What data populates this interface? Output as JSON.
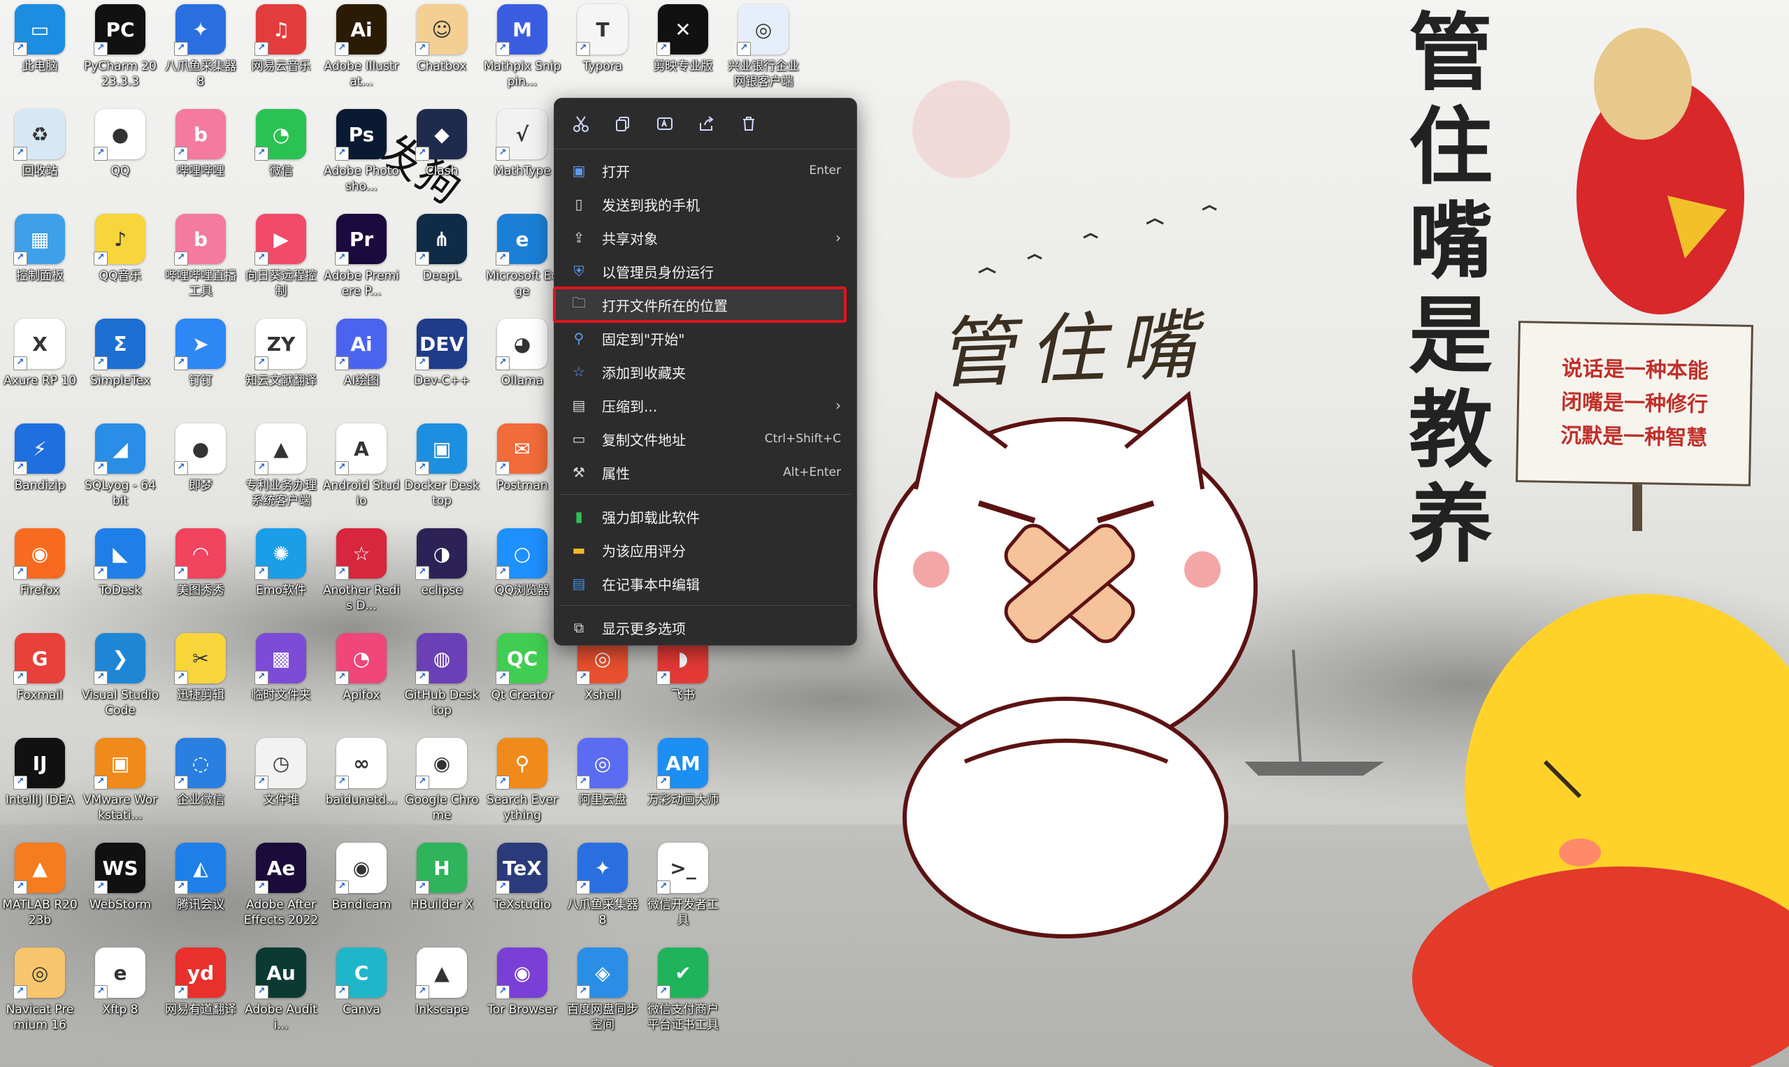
{
  "desktop": {
    "icons": [
      {
        "label": "此电脑",
        "color": "#1c8de0",
        "glyph": "▭"
      },
      {
        "label": "PyCharm 2023.3.3",
        "color": "#111111",
        "glyph": "PC"
      },
      {
        "label": "八爪鱼采集器 8",
        "color": "#2a6fe0",
        "glyph": "✦"
      },
      {
        "label": "网易云音乐",
        "color": "#e33c3c",
        "glyph": "♫"
      },
      {
        "label": "Adobe Illustrat...",
        "color": "#2b1b05",
        "glyph": "Ai"
      },
      {
        "label": "Chatbox",
        "color": "#f3cf93",
        "glyph": "☺"
      },
      {
        "label": "Mathpix Snippin...",
        "color": "#3a5de0",
        "glyph": "M"
      },
      {
        "label": "Typora",
        "color": "#f5f5f5",
        "glyph": "T"
      },
      {
        "label": "剪映专业版",
        "color": "#111111",
        "glyph": "✕"
      },
      {
        "label": "兴业银行企业网银客户端",
        "color": "#e6eef9",
        "glyph": "◎"
      },
      {
        "label": "回收站",
        "color": "#d6e8f5",
        "glyph": "♻"
      },
      {
        "label": "QQ",
        "color": "#ffffff",
        "glyph": "●"
      },
      {
        "label": "哔哩哔哩",
        "color": "#f47aa0",
        "glyph": "b"
      },
      {
        "label": "微信",
        "color": "#2bc254",
        "glyph": "◔"
      },
      {
        "label": "Adobe Photosho...",
        "color": "#0a1a33",
        "glyph": "Ps"
      },
      {
        "label": "Clash",
        "color": "#1f2b4d",
        "glyph": "◆"
      },
      {
        "label": "MathType",
        "color": "#f2f2f2",
        "glyph": "√"
      },
      {
        "label": "控制面板",
        "color": "#3ea0e8",
        "glyph": "▦"
      },
      {
        "label": "QQ音乐",
        "color": "#f7d53b",
        "glyph": "♪"
      },
      {
        "label": "哔哩哔哩直播工具",
        "color": "#f47aa0",
        "glyph": "b"
      },
      {
        "label": "向日葵远程控制",
        "color": "#f24b6a",
        "glyph": "▶"
      },
      {
        "label": "Adobe Premiere P...",
        "color": "#1b0a3d",
        "glyph": "Pr"
      },
      {
        "label": "DeepL",
        "color": "#0f2b46",
        "glyph": "⋔"
      },
      {
        "label": "Microsoft Edge",
        "color": "#1b7fd6",
        "glyph": "e"
      },
      {
        "label": "Axure RP 10",
        "color": "#ffffff",
        "glyph": "X"
      },
      {
        "label": "SimpleTex",
        "color": "#1d6fd1",
        "glyph": "Σ"
      },
      {
        "label": "钉钉",
        "color": "#2d87f5",
        "glyph": "➤"
      },
      {
        "label": "知云文献翻译",
        "color": "#ffffff",
        "glyph": "ZY"
      },
      {
        "label": "AI绘图",
        "color": "#4b64f0",
        "glyph": "Ai"
      },
      {
        "label": "Dev-C++",
        "color": "#1f3b8a",
        "glyph": "DEV"
      },
      {
        "label": "Ollama",
        "color": "#ffffff",
        "glyph": "◕"
      },
      {
        "label": "Bandizip",
        "color": "#1f6fe0",
        "glyph": "⚡"
      },
      {
        "label": "SQLyog - 64 bit",
        "color": "#2a8ee6",
        "glyph": "◢"
      },
      {
        "label": "即梦",
        "color": "#ffffff",
        "glyph": "●"
      },
      {
        "label": "专利业务办理系统客户端",
        "color": "#ffffff",
        "glyph": "▲"
      },
      {
        "label": "Android Studio",
        "color": "#ffffff",
        "glyph": "A"
      },
      {
        "label": "Docker Desktop",
        "color": "#1d8fe0",
        "glyph": "▣"
      },
      {
        "label": "Postman",
        "color": "#f26b3a",
        "glyph": "✉"
      },
      {
        "label": "Firefox",
        "color": "#f76a1f",
        "glyph": "◉"
      },
      {
        "label": "ToDesk",
        "color": "#1f7fe8",
        "glyph": "◣"
      },
      {
        "label": "美图秀秀",
        "color": "#f2435f",
        "glyph": "◠"
      },
      {
        "label": "Emo软件",
        "color": "#1a9ee8",
        "glyph": "✺"
      },
      {
        "label": "Another Redis D...",
        "color": "#d7263d",
        "glyph": "☆"
      },
      {
        "label": "eclipse",
        "color": "#2c2255",
        "glyph": "◑"
      },
      {
        "label": "QQ浏览器",
        "color": "#1e90ff",
        "glyph": "○"
      },
      {
        "label": "Foxmail",
        "color": "#e8403a",
        "glyph": "G"
      },
      {
        "label": "Visual Studio Code",
        "color": "#1f86d6",
        "glyph": "❯"
      },
      {
        "label": "迅捷剪辑",
        "color": "#f7d53b",
        "glyph": "✂"
      },
      {
        "label": "临时文件夹",
        "color": "#7d4bd6",
        "glyph": "▩"
      },
      {
        "label": "Apifox",
        "color": "#f0467a",
        "glyph": "◔"
      },
      {
        "label": "GitHub Desktop",
        "color": "#6b3fb5",
        "glyph": "◍"
      },
      {
        "label": "Qt Creator",
        "color": "#41cd52",
        "glyph": "QC"
      },
      {
        "label": "Xshell",
        "color": "#e9502f",
        "glyph": "◎"
      },
      {
        "label": "飞书",
        "color": "#e53935",
        "glyph": "◗"
      },
      {
        "label": "IntelliJ IDEA",
        "color": "#111111",
        "glyph": "IJ"
      },
      {
        "label": "VMware Workstati...",
        "color": "#f08a1a",
        "glyph": "▣"
      },
      {
        "label": "企业微信",
        "color": "#2a7fe0",
        "glyph": "◌"
      },
      {
        "label": "文件堆",
        "color": "#f2f2f2",
        "glyph": "◷"
      },
      {
        "label": "baidunetd...",
        "color": "#ffffff",
        "glyph": "∞"
      },
      {
        "label": "Google Chrome",
        "color": "#ffffff",
        "glyph": "◉"
      },
      {
        "label": "Search Everything",
        "color": "#f08a1a",
        "glyph": "⚲"
      },
      {
        "label": "阿里云盘",
        "color": "#5b6bf2",
        "glyph": "◎"
      },
      {
        "label": "万彩动画大师",
        "color": "#1d8ef2",
        "glyph": "AM"
      },
      {
        "label": "MATLAB R2023b",
        "color": "#f57c1f",
        "glyph": "▲"
      },
      {
        "label": "WebStorm",
        "color": "#111111",
        "glyph": "WS"
      },
      {
        "label": "腾讯会议",
        "color": "#1e7fe8",
        "glyph": "◭"
      },
      {
        "label": "Adobe After Effects 2022",
        "color": "#1a0b3a",
        "glyph": "Ae"
      },
      {
        "label": "Bandicam",
        "color": "#ffffff",
        "glyph": "◉"
      },
      {
        "label": "HBuilder X",
        "color": "#2fb35b",
        "glyph": "H"
      },
      {
        "label": "TeXstudio",
        "color": "#2b3a7a",
        "glyph": "TeX"
      },
      {
        "label": "八爪鱼采集器 8",
        "color": "#2a6fe0",
        "glyph": "✦"
      },
      {
        "label": "微信开发者工具",
        "color": "#ffffff",
        "glyph": ">_"
      },
      {
        "label": "Navicat Premium 16",
        "color": "#f7c56b",
        "glyph": "◎"
      },
      {
        "label": "Xftp 8",
        "color": "#ffffff",
        "glyph": "e"
      },
      {
        "label": "网易有道翻译",
        "color": "#e8302c",
        "glyph": "yd"
      },
      {
        "label": "Adobe Auditi...",
        "color": "#0b3a33",
        "glyph": "Au"
      },
      {
        "label": "Canva",
        "color": "#1fb6c9",
        "glyph": "C"
      },
      {
        "label": "Inkscape",
        "color": "#ffffff",
        "glyph": "▲"
      },
      {
        "label": "Tor Browser",
        "color": "#7a3fd6",
        "glyph": "◉"
      },
      {
        "label": "百度网盘同步空间",
        "color": "#2a8ee6",
        "glyph": "◈"
      },
      {
        "label": "微信支付商户平台证书工具",
        "color": "#1fb35b",
        "glyph": "✔"
      }
    ]
  },
  "context_menu": {
    "toolbar": [
      "cut-icon",
      "copy-icon",
      "rename-icon",
      "share-icon",
      "delete-icon"
    ],
    "items": [
      {
        "label": "打开",
        "shortcut": "Enter",
        "icon": "open-icon"
      },
      {
        "label": "发送到我的手机",
        "shortcut": "",
        "icon": "phone-icon"
      },
      {
        "label": "共享对象",
        "shortcut": "",
        "icon": "share-icon",
        "submenu": true
      },
      {
        "label": "以管理员身份运行",
        "shortcut": "",
        "icon": "shield-icon"
      },
      {
        "label": "打开文件所在的位置",
        "shortcut": "",
        "icon": "folder-icon",
        "selected": true
      },
      {
        "label": "固定到\"开始\"",
        "shortcut": "",
        "icon": "pin-icon"
      },
      {
        "label": "添加到收藏夹",
        "shortcut": "",
        "icon": "star-icon"
      },
      {
        "label": "压缩到...",
        "shortcut": "",
        "icon": "zip-icon",
        "submenu": true
      },
      {
        "label": "复制文件地址",
        "shortcut": "Ctrl+Shift+C",
        "icon": "path-icon"
      },
      {
        "label": "属性",
        "shortcut": "Alt+Enter",
        "icon": "wrench-icon"
      },
      {
        "label": "强力卸载此软件",
        "shortcut": "",
        "icon": "uninstall-icon"
      },
      {
        "label": "为该应用评分",
        "shortcut": "",
        "icon": "rate-icon"
      },
      {
        "label": "在记事本中编辑",
        "shortcut": "",
        "icon": "notepad-icon"
      },
      {
        "label": "显示更多选项",
        "shortcut": "",
        "icon": "more-options-icon"
      }
    ],
    "highlight_color": "#e0141f"
  },
  "wallpaper": {
    "vertical_title": [
      "管",
      "住",
      "嘴",
      "是",
      "教",
      "养"
    ],
    "calligraphy": "管住嘴",
    "sign_lines": [
      "说话是一种本能",
      "闭嘴是一种修行",
      "沉默是一种智慧"
    ],
    "overlay_text": "发狗"
  }
}
